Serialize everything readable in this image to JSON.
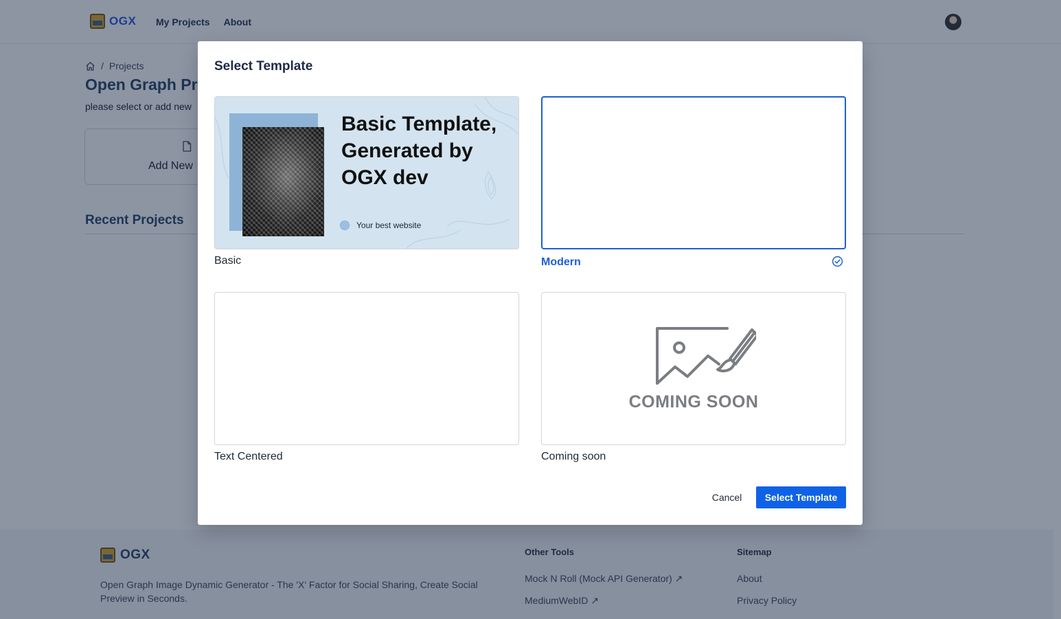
{
  "navbar": {
    "logo_text": "OGX",
    "links": [
      "My Projects",
      "About"
    ]
  },
  "page": {
    "breadcrumb_sep": "/",
    "breadcrumb_current": "Projects",
    "title": "Open Graph Pr",
    "subtitle": "please select or add new",
    "add_new_label": "Add New",
    "recent_title": "Recent Projects"
  },
  "footer": {
    "logo_text": "OGX",
    "description": "Open Graph Image Dynamic Generator - The 'X' Factor for Social Sharing, Create Social Preview in Seconds.",
    "other_tools_title": "Other Tools",
    "other_tools": [
      "Mock N Roll (Mock API Generator) ↗",
      "MediumWebID ↗"
    ],
    "sitemap_title": "Sitemap",
    "sitemap": [
      "About",
      "Privacy Policy"
    ]
  },
  "modal": {
    "title": "Select Template",
    "templates": [
      {
        "label": "Basic"
      },
      {
        "label": "Modern",
        "selected": true
      },
      {
        "label": "Text Centered"
      },
      {
        "label": "Coming soon"
      }
    ],
    "basic_preview": {
      "title": "Basic Template, Generated by OGX dev",
      "site": "Your best website"
    },
    "coming_soon_text": "COMING SOON",
    "cancel_label": "Cancel",
    "confirm_label": "Select Template"
  },
  "colors": {
    "accent": "#0f62e6",
    "selected_border": "#1d5fd6",
    "overlay": "#1b2c48",
    "basic_bg": "#d3e3ef"
  }
}
